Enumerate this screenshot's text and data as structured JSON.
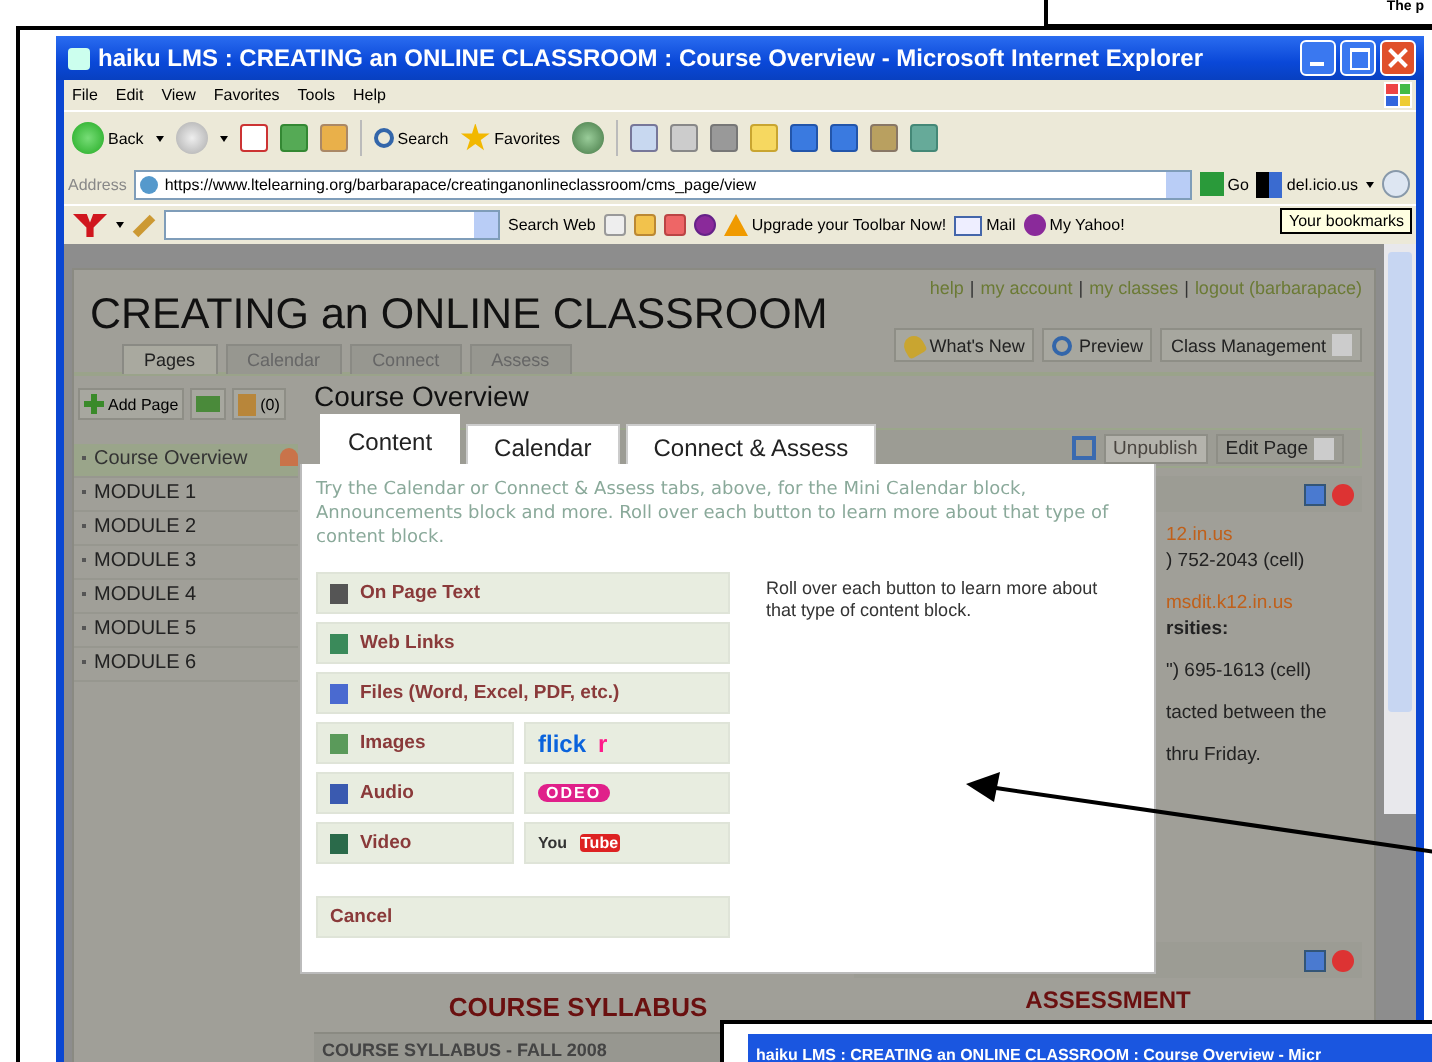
{
  "top_fragment": {
    "text": "The p"
  },
  "window": {
    "title": "haiku LMS : CREATING an ONLINE CLASSROOM : Course Overview - Microsoft Internet Explorer"
  },
  "menu": [
    "File",
    "Edit",
    "View",
    "Favorites",
    "Tools",
    "Help"
  ],
  "toolbar": {
    "back": "Back",
    "search": "Search",
    "favorites": "Favorites"
  },
  "address": {
    "label": "Address",
    "url": "https://www.ltelearning.org/barbarapace/creatinganonlineclassroom/cms_page/view",
    "go": "Go",
    "bookmarks": "del.icio.us"
  },
  "yahoo_bar": {
    "search_button": "Search Web",
    "upgrade": "Upgrade your Toolbar Now!",
    "mail": "Mail",
    "my_yahoo": "My Yahoo!",
    "tooltip": "Your bookmarks"
  },
  "page": {
    "title": "CREATING an ONLINE CLASSROOM",
    "link_separator": "|",
    "links": [
      "help",
      "my account",
      "my classes",
      "logout (barbarapace)"
    ],
    "header_buttons": [
      {
        "kind": "news",
        "label": "What's New"
      },
      {
        "kind": "preview",
        "label": "Preview"
      },
      {
        "kind": "menu",
        "label": "Class Management"
      }
    ],
    "tabs": [
      {
        "label": "Pages",
        "selected": true
      },
      {
        "label": "Calendar",
        "selected": false
      },
      {
        "label": "Connect",
        "selected": false
      },
      {
        "label": "Assess",
        "selected": false
      }
    ]
  },
  "sidebar": {
    "add_page": "Add Page",
    "clipboard": "(0)",
    "items": [
      {
        "label": "Course Overview",
        "selected": true
      },
      {
        "label": "MODULE 1",
        "selected": false
      },
      {
        "label": "MODULE 2",
        "selected": false
      },
      {
        "label": "MODULE 3",
        "selected": false
      },
      {
        "label": "MODULE 4",
        "selected": false
      },
      {
        "label": "MODULE 5",
        "selected": false
      },
      {
        "label": "MODULE 6",
        "selected": false
      }
    ]
  },
  "main": {
    "heading": "Course Overview",
    "unpublish": {
      "label": "Unpublish",
      "disabled": true
    },
    "edit_page": "Edit Page",
    "contact_fragments": [
      {
        "kind": "link",
        "text": "12.in.us"
      },
      {
        "kind": "plain",
        "text": ") 752-2043 (cell)"
      },
      {
        "kind": "link",
        "text": "msdit.k12.in.us"
      },
      {
        "kind": "bold",
        "text": "rsities:"
      },
      {
        "kind": "plain",
        "text": "\") 695-1613 (cell)"
      },
      {
        "kind": "plain",
        "text": "tacted between the"
      },
      {
        "kind": "plain",
        "text": "thru Friday."
      }
    ],
    "syllabus_heading": "COURSE SYLLABUS",
    "syllabus_bar": "COURSE SYLLABUS - FALL 2008",
    "assessment_heading": "ASSESSMENT"
  },
  "dialog": {
    "tabs": [
      {
        "label": "Content",
        "selected": true
      },
      {
        "label": "Calendar",
        "selected": false
      },
      {
        "label": "Connect & Assess",
        "selected": false
      }
    ],
    "intro": "Try the Calendar or Connect & Assess tabs, above, for the Mini Calendar block, Announcements block and more. Roll over each button to learn more about that type of content block.",
    "buttons": [
      {
        "kind": "text",
        "label": "On Page Text"
      },
      {
        "kind": "links",
        "label": "Web Links"
      },
      {
        "kind": "files",
        "label": "Files (Word, Excel, PDF, etc.)"
      }
    ],
    "media_rows": [
      {
        "kind": "images",
        "label": "Images",
        "service": {
          "kind": "flickr",
          "parts": [
            "flick",
            "r"
          ]
        }
      },
      {
        "kind": "audio",
        "label": "Audio",
        "service": {
          "kind": "odeo",
          "parts": [
            "ODEO"
          ]
        }
      },
      {
        "kind": "video",
        "label": "Video",
        "service": {
          "kind": "youtube",
          "parts": [
            "You",
            "Tube"
          ]
        }
      }
    ],
    "cancel": "Cancel",
    "hint": "Roll over each button to learn more about that type of content block."
  },
  "second_window": {
    "title": "haiku LMS : CREATING an ONLINE CLASSROOM : Course Overview - Micr"
  }
}
